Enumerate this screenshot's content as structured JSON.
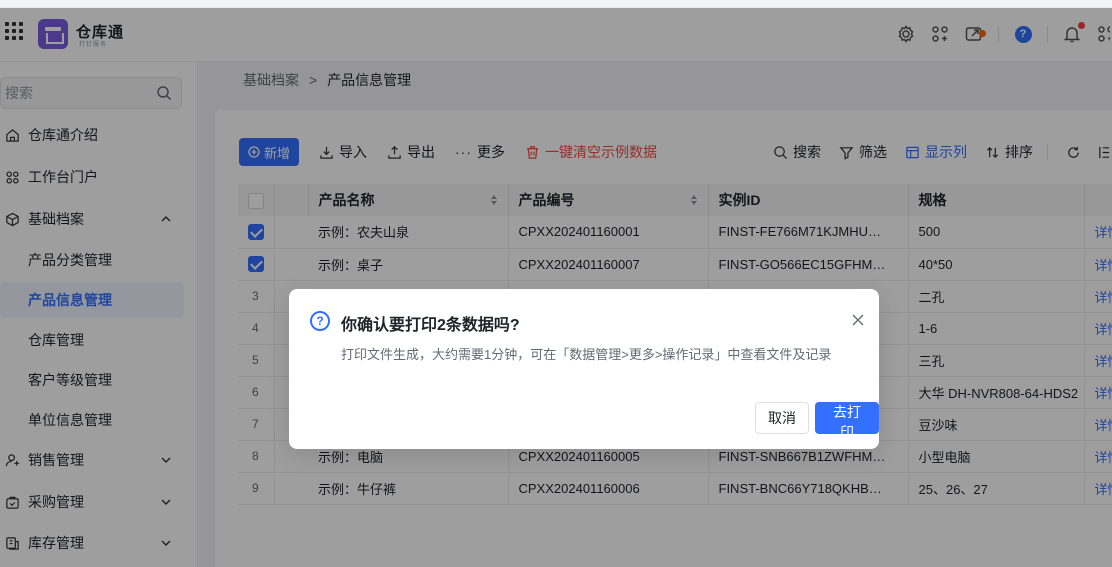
{
  "header": {
    "brand": "仓库通",
    "brand_sub": "打钉服务",
    "icons": [
      "settings-icon",
      "apps-icon",
      "screen-share-icon",
      "help-icon",
      "bell-icon",
      "plugin-icon"
    ]
  },
  "sidebar": {
    "search_placeholder": "搜索",
    "items": [
      {
        "label": "仓库通介绍",
        "icon": "home-icon"
      },
      {
        "label": "工作台门户",
        "icon": "portal-icon"
      },
      {
        "label": "基础档案",
        "icon": "cube-icon",
        "expanded": true
      },
      {
        "label": "产品分类管理",
        "sub": true
      },
      {
        "label": "产品信息管理",
        "sub": true,
        "active": true
      },
      {
        "label": "仓库管理",
        "sub": true
      },
      {
        "label": "客户等级管理",
        "sub": true
      },
      {
        "label": "单位信息管理",
        "sub": true
      },
      {
        "label": "销售管理",
        "icon": "user-icon"
      },
      {
        "label": "采购管理",
        "icon": "bag-icon"
      },
      {
        "label": "库存管理",
        "icon": "stock-icon"
      }
    ]
  },
  "breadcrumb": {
    "parent": "基础档案",
    "sep": ">",
    "current": "产品信息管理"
  },
  "toolbar": {
    "new": "新增",
    "import": "导入",
    "export": "导出",
    "more": "更多",
    "clear": "一键清空示例数据",
    "search": "搜索",
    "filter": "筛选",
    "columns": "显示列",
    "sort": "排序"
  },
  "table": {
    "columns": [
      "产品名称",
      "产品编号",
      "实例ID",
      "规格"
    ],
    "action_label": "详情",
    "rows": [
      {
        "idx": "",
        "checked": true,
        "name": "示例：农夫山泉",
        "code": "CPXX202401160001",
        "id": "FINST-FE766M71KJMHU…",
        "spec": "500"
      },
      {
        "idx": "",
        "checked": true,
        "name": "示例：桌子",
        "code": "CPXX202401160007",
        "id": "FINST-GO566EC15GFHM…",
        "spec": "40*50"
      },
      {
        "idx": "3",
        "checked": false,
        "name": "",
        "code": "",
        "id": "",
        "spec": "二孔"
      },
      {
        "idx": "4",
        "checked": false,
        "name": "",
        "code": "",
        "id": "",
        "spec": "1-6"
      },
      {
        "idx": "5",
        "checked": false,
        "name": "",
        "code": "",
        "id": "",
        "spec": "三孔"
      },
      {
        "idx": "6",
        "checked": false,
        "name": "",
        "code": "",
        "id": "",
        "spec": "大华 DH-NVR808-64-HDS2"
      },
      {
        "idx": "7",
        "checked": false,
        "name": "",
        "code": "",
        "id": "",
        "spec": "豆沙味"
      },
      {
        "idx": "8",
        "checked": false,
        "name": "示例：电脑",
        "code": "CPXX202401160005",
        "id": "FINST-SNB667B1ZWFHM…",
        "spec": "小型电脑"
      },
      {
        "idx": "9",
        "checked": false,
        "name": "示例：牛仔裤",
        "code": "CPXX202401160006",
        "id": "FINST-BNC66Y718QKHB…",
        "spec": "25、26、27"
      }
    ]
  },
  "dialog": {
    "title": "你确认要打印2条数据吗?",
    "description": "打印文件生成，大约需要1分钟，可在「数据管理>更多>操作记录」中查看文件及记录",
    "cancel": "取消",
    "confirm": "去打印"
  },
  "colors": {
    "primary": "#3370ff",
    "danger": "#f54a45",
    "overlay": "rgba(0,0,0,0.38)"
  }
}
